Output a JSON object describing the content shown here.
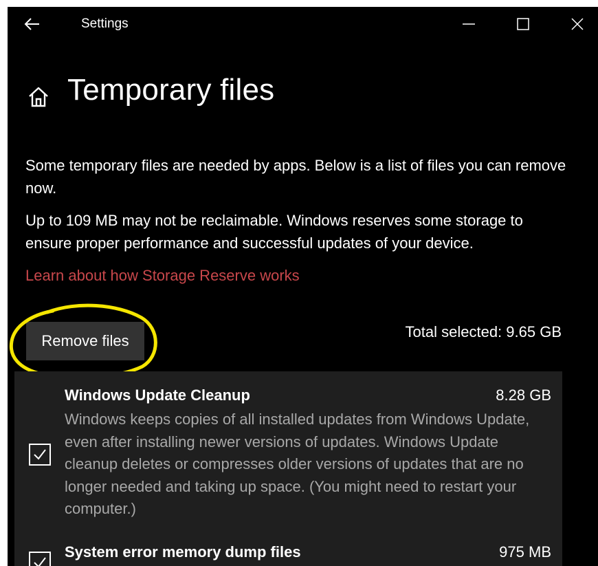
{
  "titlebar": {
    "title": "Settings",
    "back_icon": "back-arrow-icon",
    "minimize_icon": "minimize-icon",
    "maximize_icon": "maximize-icon",
    "close_icon": "close-icon"
  },
  "header": {
    "home_icon": "home-icon",
    "title": "Temporary files"
  },
  "description": {
    "line1": "Some temporary files are needed by apps. Below is a list of files you can remove now.",
    "line2": "Up to 109 MB may not be reclaimable. Windows reserves some storage to ensure proper performance and successful updates of your device.",
    "link": "Learn about how Storage Reserve works"
  },
  "actions": {
    "remove_label": "Remove files",
    "total_selected": "Total selected: 9.65 GB"
  },
  "items": [
    {
      "name": "Windows Update Cleanup",
      "size": "8.28 GB",
      "checked": true,
      "description": "Windows keeps copies of all installed updates from Windows Update, even after installing newer versions of updates. Windows Update cleanup deletes or compresses older versions of updates that are no longer needed and taking up space. (You might need to restart your computer.)"
    },
    {
      "name": "System error memory dump files",
      "size": "975 MB",
      "checked": true,
      "description": ""
    }
  ],
  "colors": {
    "background": "#000000",
    "link": "#c8474b",
    "button": "#333333",
    "list_background": "#1f1f1f",
    "secondary_text": "#a8a8a8",
    "annotation": "#f5e600"
  }
}
